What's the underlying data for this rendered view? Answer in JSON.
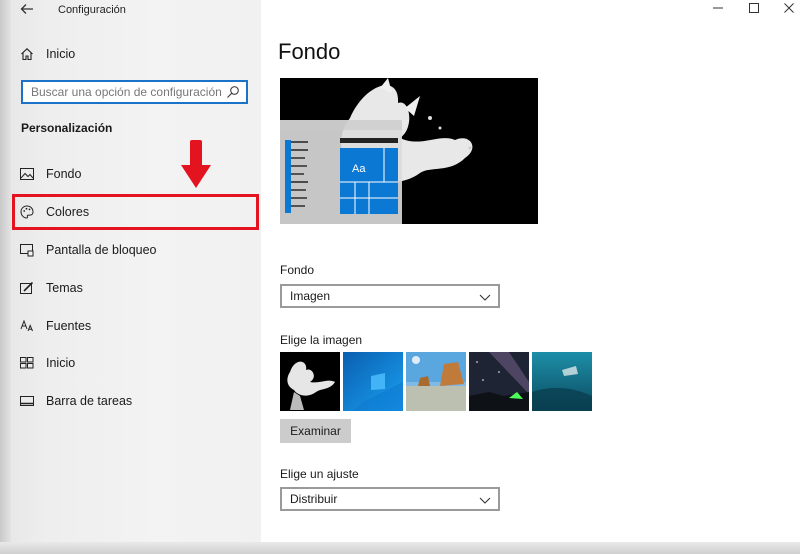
{
  "window": {
    "title": "Configuración",
    "controls": {
      "minimize": "—",
      "maximize": "☐",
      "close": "✕"
    }
  },
  "sidebar": {
    "home_label": "Inicio",
    "search_placeholder": "Buscar una opción de configuración",
    "section_title": "Personalización",
    "items": [
      {
        "label": "Fondo",
        "icon": "picture-icon"
      },
      {
        "label": "Colores",
        "icon": "palette-icon",
        "highlighted": true
      },
      {
        "label": "Pantalla de bloqueo",
        "icon": "lock-screen-icon"
      },
      {
        "label": "Temas",
        "icon": "brush-icon"
      },
      {
        "label": "Fuentes",
        "icon": "font-icon"
      },
      {
        "label": "Inicio",
        "icon": "start-icon"
      },
      {
        "label": "Barra de tareas",
        "icon": "taskbar-icon"
      }
    ]
  },
  "main": {
    "title": "Fondo",
    "preview_tile_text": "Aa",
    "background_label": "Fondo",
    "background_value": "Imagen",
    "choose_image_label": "Elige la imagen",
    "browse_button": "Examinar",
    "fit_label": "Elige un ajuste",
    "fit_value": "Distribuir"
  },
  "colors": {
    "accent": "#0b78d4",
    "highlight_red": "#e3141f",
    "search_border": "#1a73c9"
  }
}
